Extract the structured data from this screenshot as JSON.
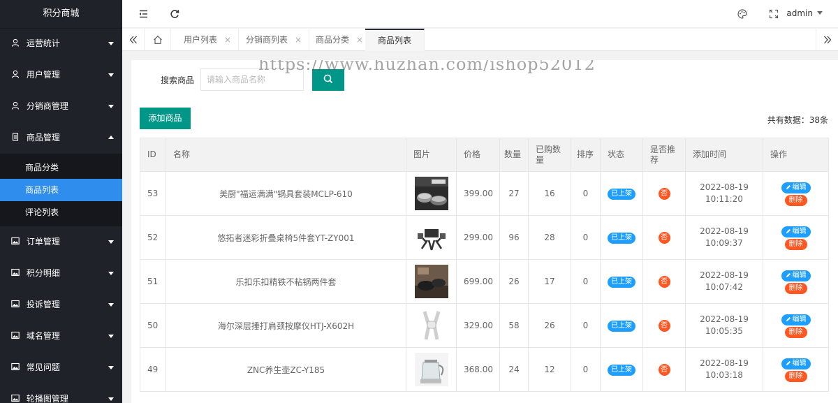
{
  "app": {
    "title": "积分商城"
  },
  "sidebar": {
    "items": [
      {
        "label": "运营统计",
        "icon": "user-icon"
      },
      {
        "label": "用户管理",
        "icon": "user-icon"
      },
      {
        "label": "分销商管理",
        "icon": "user-icon"
      },
      {
        "label": "商品管理",
        "icon": "document-icon",
        "open": true,
        "children": [
          {
            "label": "商品分类"
          },
          {
            "label": "商品列表",
            "active": true
          },
          {
            "label": "评论列表"
          }
        ]
      },
      {
        "label": "订单管理",
        "icon": "image-icon"
      },
      {
        "label": "积分明细",
        "icon": "image-icon"
      },
      {
        "label": "投诉管理",
        "icon": "image-icon"
      },
      {
        "label": "域名管理",
        "icon": "image-icon"
      },
      {
        "label": "常见问题",
        "icon": "image-icon"
      },
      {
        "label": "轮播图管理",
        "icon": "image-icon"
      }
    ]
  },
  "header": {
    "user": "admin"
  },
  "tabs": [
    {
      "label": "用户列表",
      "close": "×"
    },
    {
      "label": "分销商列表",
      "close": "×"
    },
    {
      "label": "商品分类",
      "close": "×"
    },
    {
      "label": "商品列表",
      "active": true
    }
  ],
  "search": {
    "label": "搜索商品",
    "placeholder": "请输入商品名称"
  },
  "toolbar": {
    "add_label": "添加商品",
    "total_label": "共有数据：",
    "total_value": "38条"
  },
  "watermark": "https://www.huzhan.com/ishop52012",
  "table": {
    "headers": {
      "id": "ID",
      "name": "名称",
      "image": "图片",
      "price": "价格",
      "qty": "数量",
      "sold": "已购数量",
      "sort": "排序",
      "status": "状态",
      "recommend": "是否推荐",
      "time": "添加时间",
      "ops": "操作"
    },
    "rows": [
      {
        "id": "53",
        "name": "美厨\"福运满满\"锅具套装MCLP-610",
        "price": "399.00",
        "qty": "27",
        "sold": "16",
        "sort": "0",
        "status": "已上架",
        "recommend": "否",
        "date": "2022-08-19",
        "time": "10:11:20",
        "edit": "编辑",
        "delete": "删除"
      },
      {
        "id": "52",
        "name": "悠拓者迷彩折叠桌椅5件套YT-ZY001",
        "price": "299.00",
        "qty": "96",
        "sold": "28",
        "sort": "0",
        "status": "已上架",
        "recommend": "否",
        "date": "2022-08-19",
        "time": "10:09:37",
        "edit": "编辑",
        "delete": "删除"
      },
      {
        "id": "51",
        "name": "乐扣乐扣精铁不粘锅两件套",
        "price": "699.00",
        "qty": "26",
        "sold": "17",
        "sort": "0",
        "status": "已上架",
        "recommend": "否",
        "date": "2022-08-19",
        "time": "10:07:42",
        "edit": "编辑",
        "delete": "删除"
      },
      {
        "id": "50",
        "name": "海尔深层捶打肩颈按摩仪HTJ-X602H",
        "price": "329.00",
        "qty": "58",
        "sold": "26",
        "sort": "0",
        "status": "已上架",
        "recommend": "否",
        "date": "2022-08-19",
        "time": "10:05:35",
        "edit": "编辑",
        "delete": "删除"
      },
      {
        "id": "49",
        "name": "ZNC养生壶ZC-Y185",
        "price": "368.00",
        "qty": "24",
        "sold": "12",
        "sort": "0",
        "status": "已上架",
        "recommend": "否",
        "date": "2022-08-19",
        "time": "10:03:18",
        "edit": "编辑",
        "delete": "删除"
      }
    ]
  },
  "colors": {
    "sidebar_bg": "#20222a",
    "active": "#2e8ded",
    "primary": "#009688",
    "blue": "#1e9fff",
    "orange": "#ff5722"
  }
}
